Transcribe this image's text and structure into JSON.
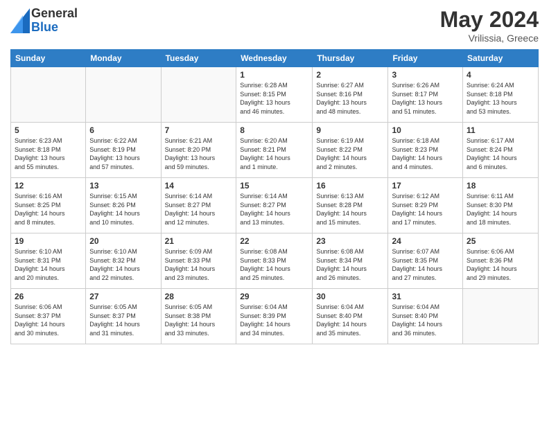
{
  "header": {
    "logo_general": "General",
    "logo_blue": "Blue",
    "month_title": "May 2024",
    "location": "Vrilissia, Greece"
  },
  "days_of_week": [
    "Sunday",
    "Monday",
    "Tuesday",
    "Wednesday",
    "Thursday",
    "Friday",
    "Saturday"
  ],
  "weeks": [
    [
      {
        "day": "",
        "info": ""
      },
      {
        "day": "",
        "info": ""
      },
      {
        "day": "",
        "info": ""
      },
      {
        "day": "1",
        "info": "Sunrise: 6:28 AM\nSunset: 8:15 PM\nDaylight: 13 hours\nand 46 minutes."
      },
      {
        "day": "2",
        "info": "Sunrise: 6:27 AM\nSunset: 8:16 PM\nDaylight: 13 hours\nand 48 minutes."
      },
      {
        "day": "3",
        "info": "Sunrise: 6:26 AM\nSunset: 8:17 PM\nDaylight: 13 hours\nand 51 minutes."
      },
      {
        "day": "4",
        "info": "Sunrise: 6:24 AM\nSunset: 8:18 PM\nDaylight: 13 hours\nand 53 minutes."
      }
    ],
    [
      {
        "day": "5",
        "info": "Sunrise: 6:23 AM\nSunset: 8:18 PM\nDaylight: 13 hours\nand 55 minutes."
      },
      {
        "day": "6",
        "info": "Sunrise: 6:22 AM\nSunset: 8:19 PM\nDaylight: 13 hours\nand 57 minutes."
      },
      {
        "day": "7",
        "info": "Sunrise: 6:21 AM\nSunset: 8:20 PM\nDaylight: 13 hours\nand 59 minutes."
      },
      {
        "day": "8",
        "info": "Sunrise: 6:20 AM\nSunset: 8:21 PM\nDaylight: 14 hours\nand 1 minute."
      },
      {
        "day": "9",
        "info": "Sunrise: 6:19 AM\nSunset: 8:22 PM\nDaylight: 14 hours\nand 2 minutes."
      },
      {
        "day": "10",
        "info": "Sunrise: 6:18 AM\nSunset: 8:23 PM\nDaylight: 14 hours\nand 4 minutes."
      },
      {
        "day": "11",
        "info": "Sunrise: 6:17 AM\nSunset: 8:24 PM\nDaylight: 14 hours\nand 6 minutes."
      }
    ],
    [
      {
        "day": "12",
        "info": "Sunrise: 6:16 AM\nSunset: 8:25 PM\nDaylight: 14 hours\nand 8 minutes."
      },
      {
        "day": "13",
        "info": "Sunrise: 6:15 AM\nSunset: 8:26 PM\nDaylight: 14 hours\nand 10 minutes."
      },
      {
        "day": "14",
        "info": "Sunrise: 6:14 AM\nSunset: 8:27 PM\nDaylight: 14 hours\nand 12 minutes."
      },
      {
        "day": "15",
        "info": "Sunrise: 6:14 AM\nSunset: 8:27 PM\nDaylight: 14 hours\nand 13 minutes."
      },
      {
        "day": "16",
        "info": "Sunrise: 6:13 AM\nSunset: 8:28 PM\nDaylight: 14 hours\nand 15 minutes."
      },
      {
        "day": "17",
        "info": "Sunrise: 6:12 AM\nSunset: 8:29 PM\nDaylight: 14 hours\nand 17 minutes."
      },
      {
        "day": "18",
        "info": "Sunrise: 6:11 AM\nSunset: 8:30 PM\nDaylight: 14 hours\nand 18 minutes."
      }
    ],
    [
      {
        "day": "19",
        "info": "Sunrise: 6:10 AM\nSunset: 8:31 PM\nDaylight: 14 hours\nand 20 minutes."
      },
      {
        "day": "20",
        "info": "Sunrise: 6:10 AM\nSunset: 8:32 PM\nDaylight: 14 hours\nand 22 minutes."
      },
      {
        "day": "21",
        "info": "Sunrise: 6:09 AM\nSunset: 8:33 PM\nDaylight: 14 hours\nand 23 minutes."
      },
      {
        "day": "22",
        "info": "Sunrise: 6:08 AM\nSunset: 8:33 PM\nDaylight: 14 hours\nand 25 minutes."
      },
      {
        "day": "23",
        "info": "Sunrise: 6:08 AM\nSunset: 8:34 PM\nDaylight: 14 hours\nand 26 minutes."
      },
      {
        "day": "24",
        "info": "Sunrise: 6:07 AM\nSunset: 8:35 PM\nDaylight: 14 hours\nand 27 minutes."
      },
      {
        "day": "25",
        "info": "Sunrise: 6:06 AM\nSunset: 8:36 PM\nDaylight: 14 hours\nand 29 minutes."
      }
    ],
    [
      {
        "day": "26",
        "info": "Sunrise: 6:06 AM\nSunset: 8:37 PM\nDaylight: 14 hours\nand 30 minutes."
      },
      {
        "day": "27",
        "info": "Sunrise: 6:05 AM\nSunset: 8:37 PM\nDaylight: 14 hours\nand 31 minutes."
      },
      {
        "day": "28",
        "info": "Sunrise: 6:05 AM\nSunset: 8:38 PM\nDaylight: 14 hours\nand 33 minutes."
      },
      {
        "day": "29",
        "info": "Sunrise: 6:04 AM\nSunset: 8:39 PM\nDaylight: 14 hours\nand 34 minutes."
      },
      {
        "day": "30",
        "info": "Sunrise: 6:04 AM\nSunset: 8:40 PM\nDaylight: 14 hours\nand 35 minutes."
      },
      {
        "day": "31",
        "info": "Sunrise: 6:04 AM\nSunset: 8:40 PM\nDaylight: 14 hours\nand 36 minutes."
      },
      {
        "day": "",
        "info": ""
      }
    ]
  ]
}
